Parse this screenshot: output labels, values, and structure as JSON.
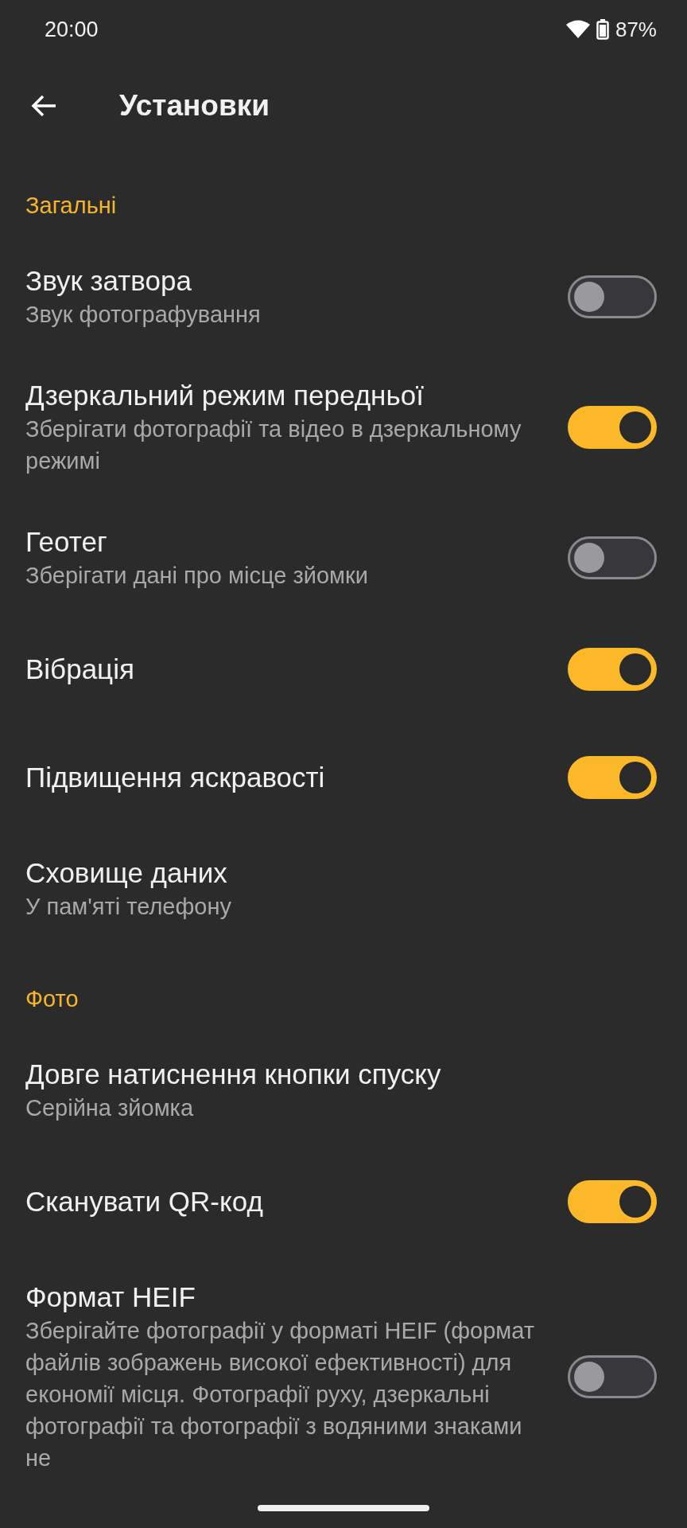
{
  "status_bar": {
    "time": "20:00",
    "battery": "87%"
  },
  "app_bar": {
    "title": "Установки"
  },
  "sections": [
    {
      "header": "Загальні",
      "items": [
        {
          "kind": "toggle",
          "title": "Звук затвора",
          "subtitle": "Звук фотографування",
          "on": false
        },
        {
          "kind": "toggle",
          "title": "Дзеркальний режим передньої",
          "subtitle": "Зберігати фотографії та відео в дзеркальному режимі",
          "on": true
        },
        {
          "kind": "toggle",
          "title": "Геотег",
          "subtitle": "Зберігати дані про місце зйомки",
          "on": false
        },
        {
          "kind": "toggle",
          "title": "Вібрація",
          "on": true
        },
        {
          "kind": "toggle",
          "title": "Підвищення яскравості",
          "on": true
        },
        {
          "kind": "text",
          "title": "Сховище даних",
          "subtitle": "У пам'яті телефону"
        }
      ]
    },
    {
      "header": "Фото",
      "items": [
        {
          "kind": "text",
          "title": "Довге натиснення кнопки спуску",
          "subtitle": "Серійна зйомка"
        },
        {
          "kind": "toggle",
          "title": "Сканувати QR-код",
          "on": true
        },
        {
          "kind": "toggle",
          "title": "Формат HEIF",
          "subtitle": "Зберігайте фотографії у форматі HEIF (формат файлів зображень високої ефективності) для економії місця. Фотографії руху, дзеркальні фотографії та фотографії з водяними знаками не",
          "on": false
        }
      ]
    }
  ]
}
